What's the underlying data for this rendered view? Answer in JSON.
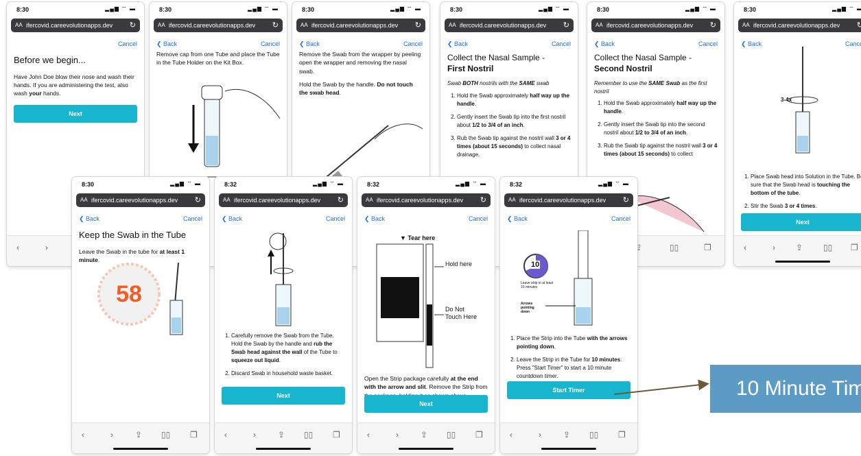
{
  "status": {
    "time_a": "8:30",
    "time_b": "8:32",
    "signal": "▂▄▆ ⌔ ▬"
  },
  "browser": {
    "aa": "AA",
    "url": "ifercovid.careevolutionapps.dev",
    "back": "Back",
    "cancel": "Cancel"
  },
  "screen1": {
    "title": "Before we begin...",
    "body_pre": "Have John Doe blow their nose and wash their hands. If you are administering the test, also wash ",
    "body_bold": "your",
    "body_post": " hands.",
    "button": "Next"
  },
  "screen2": {
    "body": "Remove cap from one Tube and place the Tube in the Tube Holder on the Kit Box."
  },
  "screen3": {
    "body1": "Remove the Swab from the wrapper by peeling open the wrapper and removing the nasal swab.",
    "body2_pre": "Hold the Swab by the handle. ",
    "body2_bold": "Do not touch the swab head",
    "body2_post": "."
  },
  "screen4": {
    "title_line1": "Collect the Nasal Sample -",
    "title_line2": "First Nostril",
    "subtitle_pre": "Swab ",
    "subtitle_b1": "BOTH",
    "subtitle_mid": " nostrils with the ",
    "subtitle_b2": "SAME",
    "subtitle_post": " swab",
    "step1_pre": "Hold the Swab approximately ",
    "step1_bold": "half way up the handle",
    "step1_post": ".",
    "step2_pre": "Gently insert the Swab tip into the first nostril about ",
    "step2_bold": "1/2 to 3/4 of an inch",
    "step2_post": ".",
    "step3_pre": "Rub the Swab tip against the nostril wall ",
    "step3_bold": "3 or 4 times (about 15 seconds)",
    "step3_post": " to collect nasal drainage."
  },
  "screen5": {
    "title_line1": "Collect the Nasal Sample -",
    "title_line2": "Second Nostril",
    "subtitle_pre": "Remember to use the ",
    "subtitle_bold": "SAME Swab",
    "subtitle_post": " as the first nostril",
    "step1_pre": "Hold the Swab approximately ",
    "step1_bold": "half way up the handle",
    "step1_post": ".",
    "step2_pre": "Gently insert the Swab tip into the second nostril about ",
    "step2_bold": "1/2 to 3/4 of an inch",
    "step2_post": ".",
    "step3_pre": "Rub the Swab tip against the nostril wall ",
    "step3_bold": "3 or 4 times (about 15 seconds)",
    "step3_post": " to collect",
    "step3_tail": "age."
  },
  "screen6": {
    "count_label": "3-4x",
    "step1_pre": "Place Swab head into Solution in the Tube. Be sure that the Swab head is ",
    "step1_bold": "touching the bottom of the tube",
    "step1_post": ".",
    "step2_pre": "Stir the Swab ",
    "step2_bold": "3 or 4 times",
    "step2_post": ".",
    "button": "Next"
  },
  "screen7": {
    "title": "Keep the Swab in the Tube",
    "body_pre": "Leave the Swab in the tube for ",
    "body_bold": "at least 1 minute",
    "body_post": ".",
    "countdown": "58"
  },
  "screen8": {
    "step1_pre": "Carefully remove the Swab from the Tube. Hold the Swab by the handle and ",
    "step1_bold1": "rub the Swab head against the wall",
    "step1_mid": " of the Tube to ",
    "step1_bold2": "squeeze out liquid",
    "step1_post": ".",
    "step2": "Discard Swab in household waste basket.",
    "button": "Next"
  },
  "screen9": {
    "tear": "Tear here",
    "hold": "Hold here",
    "donot": "Do Not Touch Here",
    "body_pre": "Open the Strip package carefully ",
    "body_bold": "at the end with the arrow and slit",
    "body_post": ". Remove the Strip from the package, holding it as shown above.",
    "button": "Next"
  },
  "screen10": {
    "clock_num": "10",
    "clock_label": "Leave strip in at least 10 minutes",
    "arrows_label": "Arrows pointing down",
    "step1_pre": "Place the Strip into the Tube ",
    "step1_bold": "with the arrows pointing down",
    "step1_post": ".",
    "step2_pre": "Leave the Strip in the Tube for ",
    "step2_bold": "10 minutes",
    "step2_post": ". Press \"Start Timer\" to start a 10 minute countdown timer.",
    "button": "Start Timer"
  },
  "callout": {
    "label": "10 Minute Timer"
  },
  "colors": {
    "accent": "#18b5cf",
    "link": "#1b6ff5",
    "timer": "#f25c27",
    "callout": "#5b9bc4"
  }
}
